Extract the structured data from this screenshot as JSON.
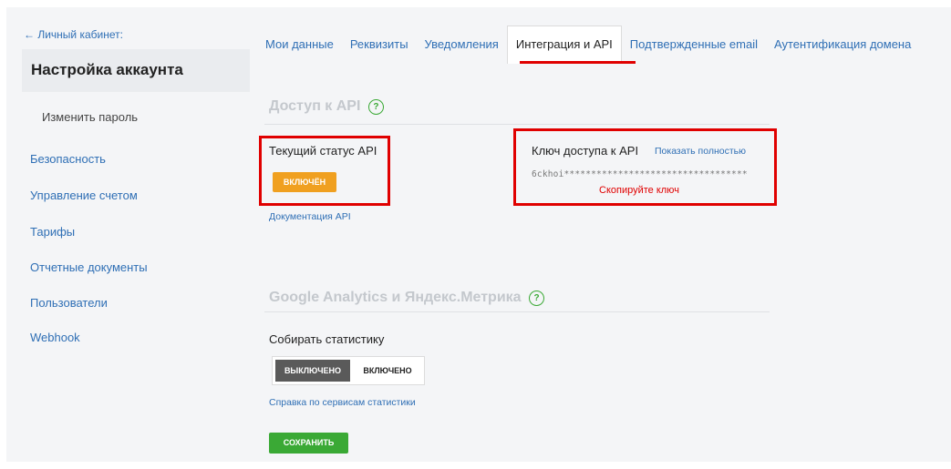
{
  "sidebar": {
    "back_link": "← Личный кабинет:",
    "title": "Настройка аккаунта",
    "subitem": "Изменить пароль",
    "items": [
      {
        "label": "Безопасность"
      },
      {
        "label": "Управление счетом"
      },
      {
        "label": "Тарифы"
      },
      {
        "label": "Отчетные документы"
      },
      {
        "label": "Пользователи"
      },
      {
        "label": "Webhook"
      }
    ]
  },
  "tabs": [
    {
      "label": "Мои данные"
    },
    {
      "label": "Реквизиты"
    },
    {
      "label": "Уведомления"
    },
    {
      "label": "Интеграция и API",
      "active": true
    },
    {
      "label": "Подтвержденные email"
    },
    {
      "label": "Аутентификация домена"
    }
  ],
  "api": {
    "section_title": "Доступ к API",
    "status_label": "Текущий статус API",
    "status_button": "ВКЛЮЧЁН",
    "docs_link": "Документация API",
    "key_label": "Ключ доступа к API",
    "show_full_link": "Показать полностью",
    "key_value": "6ckhoi**********************************",
    "copy_hint": "Скопируйте ключ"
  },
  "analytics": {
    "section_title": "Google Analytics и Яндекс.Метрика",
    "collect_label": "Собирать статистику",
    "toggle_off": "ВЫКЛЮЧЕНО",
    "toggle_on": "ВКЛЮЧЕНО",
    "help_link": "Справка по сервисам статистики",
    "save_button": "СОХРАНИТЬ"
  },
  "colors": {
    "accent_link": "#2f6fb5",
    "status_on": "#f0a020",
    "save": "#3aa935",
    "highlight": "#e00000"
  }
}
